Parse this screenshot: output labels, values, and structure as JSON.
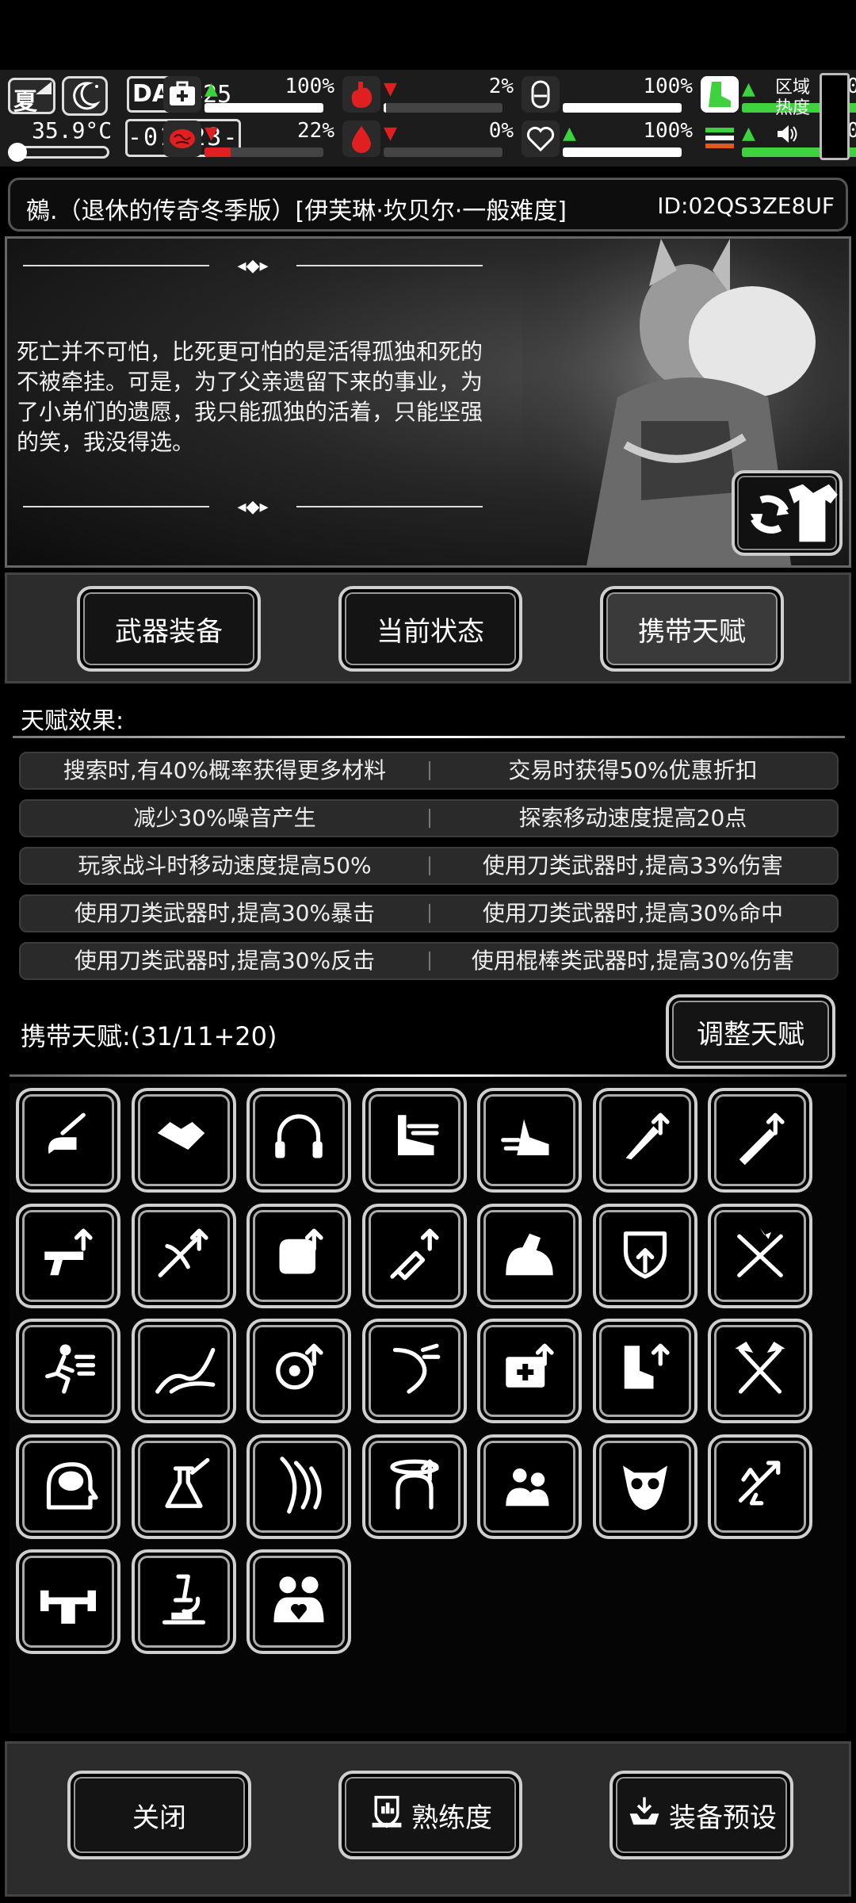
{
  "status": {
    "season": "夏",
    "temperature": "35.9°C",
    "day_label": "DAY",
    "day_number": "425",
    "time": "-01:23-",
    "stats": [
      {
        "icon": "first-aid-icon",
        "trend": "up",
        "value": "100%",
        "fill": 1.0,
        "color": "#ffffff"
      },
      {
        "icon": "stomach-icon",
        "trend": "down",
        "value": "2%",
        "fill": 0.02,
        "color": "#ffffff"
      },
      {
        "icon": "hydration-icon",
        "trend": "none",
        "value": "100%",
        "fill": 1.0,
        "color": "#ffffff"
      },
      {
        "icon": "boot-icon",
        "trend": "up",
        "value": "100%",
        "fill": 1.0,
        "color": "#3ed23e"
      },
      {
        "icon": "brain-icon",
        "trend": "down",
        "value": "22%",
        "fill": 0.22,
        "color": "#e02020"
      },
      {
        "icon": "blood-drop-icon",
        "trend": "down",
        "value": "0%",
        "fill": 0.0,
        "color": "#e02020"
      },
      {
        "icon": "heart-icon",
        "trend": "up",
        "value": "100%",
        "fill": 1.0,
        "color": "#ffffff"
      },
      {
        "icon": "stamina-icon",
        "trend": "up",
        "value": "100%",
        "fill": 1.0,
        "color": "#3ed23e"
      }
    ],
    "region_label": "区域\n热度"
  },
  "title": {
    "name": "鵺.（退休的传奇冬季版）[伊芙琳·坎贝尔·一般难度]",
    "player_id": "ID:02QS3ZE8UF"
  },
  "story": {
    "quote": "死亡并不可怕，比死更可怕的是活得孤独和死的不被牵挂。可是，为了父亲遗留下来的事业，为了小弟们的遗愿，我只能孤独的活着，只能坚强的笑，我没得选。"
  },
  "tabs": [
    {
      "label": "武器装备",
      "active": false
    },
    {
      "label": "当前状态",
      "active": false
    },
    {
      "label": "携带天赋",
      "active": true
    }
  ],
  "effects": {
    "header": "天赋效果:",
    "rows": [
      [
        "搜索时,有40%概率获得更多材料",
        "交易时获得50%优惠折扣"
      ],
      [
        "减少30%噪音产生",
        "探索移动速度提高20点"
      ],
      [
        "玩家战斗时移动速度提高50%",
        "使用刀类武器时,提高33%伤害"
      ],
      [
        "使用刀类武器时,提高30%暴击",
        "使用刀类武器时,提高30%命中"
      ],
      [
        "使用刀类武器时,提高30%反击",
        "使用棍棒类武器时,提高30%伤害"
      ]
    ]
  },
  "carried": {
    "label": "携带天赋:(31/11+20)",
    "adjust_button": "调整天赋"
  },
  "talents": [
    "search-hand-icon",
    "handshake-icon",
    "headphones-icon",
    "sneak-shoe-icon",
    "dash-icon",
    "knife-up-icon",
    "bat-up-icon",
    "pistol-up-icon",
    "crossbow-up-icon",
    "glove-up-icon",
    "syringe-up-icon",
    "muscle-icon",
    "shield-up-icon",
    "crossed-blades-icon",
    "running-man-icon",
    "road-icon",
    "target-up-icon",
    "dodge-arm-icon",
    "medkit-up-icon",
    "boot-up-icon",
    "crossed-axes-icon",
    "head-brain-icon",
    "flask-icon",
    "claw-icon",
    "dizzy-head-icon",
    "team-up-icon",
    "owl-icon",
    "recycle-arrow-icon",
    "dumbbell-icon",
    "microscope-icon",
    "couple-heart-icon"
  ],
  "bottom": {
    "close": "关闭",
    "proficiency": "熟练度",
    "preset": "装备预设"
  }
}
